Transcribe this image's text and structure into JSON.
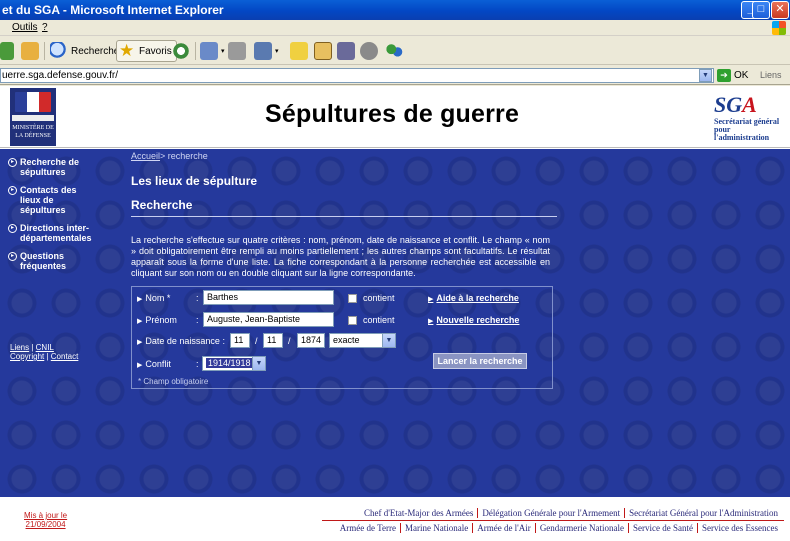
{
  "window": {
    "title": "et du SGA - Microsoft Internet Explorer"
  },
  "menu": {
    "items": [
      "Outils",
      "?"
    ]
  },
  "toolbar": {
    "rechercher": "Rechercher",
    "favoris": "Favoris"
  },
  "address": {
    "url": "uerre.sga.defense.gouv.fr/",
    "go_label": "OK",
    "links_label": "Liens"
  },
  "header": {
    "ministry_text": "MINISTÈRE DE LA DÉFENSE",
    "site_title": "Sépultures de guerre",
    "sga_logo_prefix": "SG",
    "sga_logo_accent": "A",
    "sga_subtitle": "Secrétariat général pour l'administration"
  },
  "nav": {
    "items": [
      {
        "label": "Recherche de sépultures"
      },
      {
        "label": "Contacts des lieux de sépultures"
      },
      {
        "label": "Directions inter-départementales"
      },
      {
        "label": "Questions fréquentes"
      }
    ],
    "legal_liens": "Liens",
    "legal_cnil": "CNIL",
    "legal_copyright": "Copyright",
    "legal_contact": "Contact"
  },
  "breadcrumb": {
    "home": "Accueil",
    "current": "> recherche"
  },
  "section_title": "Les lieux de sépulture",
  "subsection_title": "Recherche",
  "intro_text": "La recherche s'effectue sur quatre critères : nom, prénom, date de naissance et conflit. Le champ « nom » doit obligatoirement être rempli au moins partiellement ; les autres champs sont facultatifs. Le résultat apparaît sous la forme d'une liste. La fiche correspondant à la personne recherchée est accessible en cliquant sur son nom ou en double cliquant sur la ligne correspondante.",
  "form": {
    "nom_label": "Nom *",
    "nom_value": "Barthes",
    "prenom_label": "Prénom",
    "prenom_value": "Auguste, Jean-Baptiste",
    "contient_label": "contient",
    "dob_label": "Date de naissance :",
    "dob_day": "11",
    "dob_month": "11",
    "dob_year": "1874",
    "dob_precision": "exacte",
    "conflit_label": "Conflit",
    "conflit_value": "1914/1918",
    "aide_link": "Aide à la recherche",
    "nouvelle_link": "Nouvelle recherche",
    "submit_label": "Lancer la recherche",
    "required_note": "* Champ obligatoire"
  },
  "footer": {
    "updated_label": "Mis à jour le",
    "updated_date": "21/09/2004",
    "row1": [
      "Chef d'Etat-Major des Armées",
      "Délégation Générale pour l'Armement",
      "Secrétariat Général pour l'Administration"
    ],
    "row2": [
      "Armée de Terre",
      "Marine Nationale",
      "Armée de l'Air",
      "Gendarmerie Nationale",
      "Service de Santé",
      "Service des Essences"
    ]
  },
  "colors": {
    "page_blue": "#25399c",
    "title_bar": "#0a5fd6",
    "footer_red": "#c01818"
  }
}
